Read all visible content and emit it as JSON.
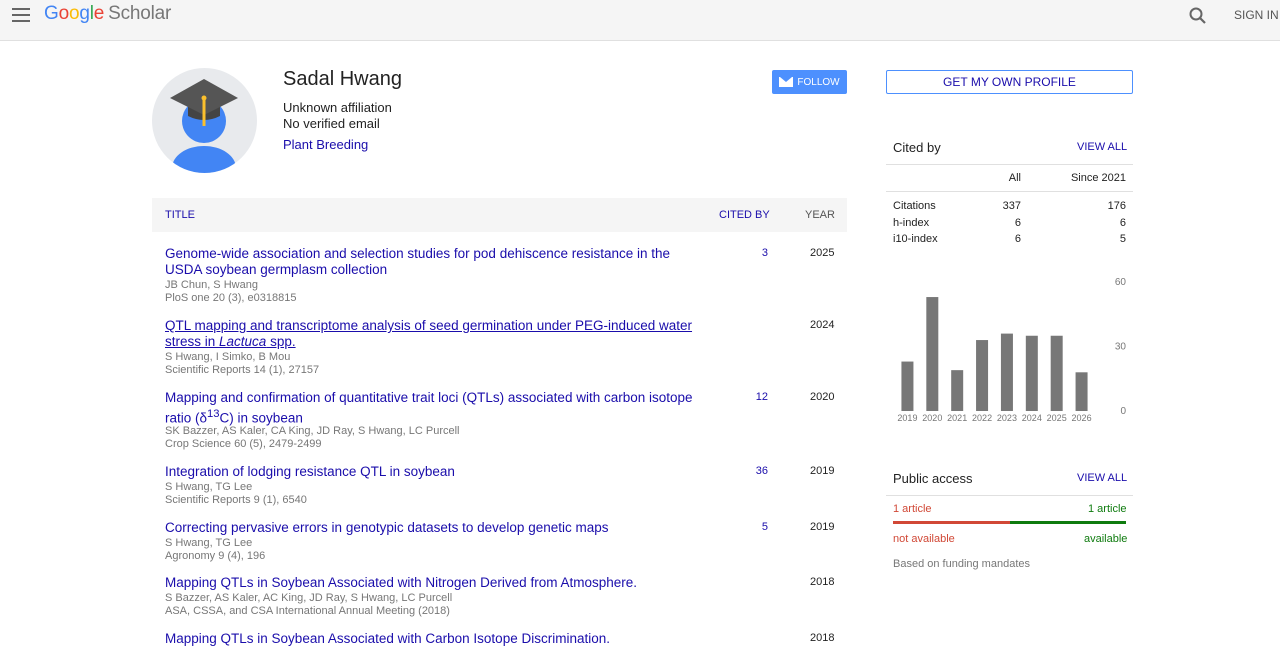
{
  "header": {
    "logo_letters": [
      "G",
      "o",
      "o",
      "g",
      "l",
      "e"
    ],
    "logo_product": "Scholar",
    "signin_label": "SIGN IN",
    "menu_icon": "hamburger-menu-icon",
    "search_icon": "search-icon"
  },
  "profile": {
    "name": "Sadal Hwang",
    "affiliation": "Unknown affiliation",
    "email": "No verified email",
    "interest": "Plant Breeding",
    "follow_label": "FOLLOW"
  },
  "table": {
    "headers": {
      "title": "TITLE",
      "cited_by": "CITED BY",
      "year": "YEAR"
    },
    "rows": [
      {
        "title": "Genome-wide association and selection studies for pod dehiscence resistance in the USDA soybean germplasm collection",
        "authors": "JB Chun, S Hwang",
        "venue": "PloS one 20 (3), e0318815",
        "cited": "3",
        "year": "2025"
      },
      {
        "title_pre": "QTL mapping and transcriptome analysis of seed germination under PEG-induced water stress in ",
        "title_italic": "Lactuca",
        "title_post": " spp.",
        "authors": "S Hwang, I Simko, B Mou",
        "venue": "Scientific Reports 14 (1), 27157",
        "cited": "",
        "year": "2024"
      },
      {
        "title_pre": "Mapping and confirmation of quantitative trait loci (QTLs) associated with carbon isotope ratio (δ",
        "title_sup": "13",
        "title_post": "C) in soybean",
        "authors": "SK Bazzer, AS Kaler, CA King, JD Ray, S Hwang, LC Purcell",
        "venue": "Crop Science 60 (5), 2479-2499",
        "cited": "12",
        "year": "2020"
      },
      {
        "title": "Integration of lodging resistance QTL in soybean",
        "authors": "S Hwang, TG Lee",
        "venue": "Scientific Reports 9 (1), 6540",
        "cited": "36",
        "year": "2019"
      },
      {
        "title": "Correcting pervasive errors in genotypic datasets to develop genetic maps",
        "authors": "S Hwang, TG Lee",
        "venue": "Agronomy 9 (4), 196",
        "cited": "5",
        "year": "2019"
      },
      {
        "title": "Mapping QTLs in Soybean Associated with Nitrogen Derived from Atmosphere.",
        "authors": "S Bazzer, AS Kaler, AC King, JD Ray, S Hwang, LC Purcell",
        "venue": "ASA, CSSA, and CSA International Annual Meeting (2018)",
        "cited": "",
        "year": "2018"
      },
      {
        "title": "Mapping QTLs in Soybean Associated with Carbon Isotope Discrimination.",
        "authors": "",
        "venue": "",
        "cited": "",
        "year": "2018"
      }
    ]
  },
  "sidebar": {
    "get_profile_label": "GET MY OWN PROFILE",
    "cited_by_title": "Cited by",
    "view_all": "VIEW ALL",
    "col_all": "All",
    "col_since": "Since 2021",
    "metrics": [
      {
        "label": "Citations",
        "all": "337",
        "since": "176"
      },
      {
        "label": "h-index",
        "all": "6",
        "since": "6"
      },
      {
        "label": "i10-index",
        "all": "6",
        "since": "5"
      }
    ],
    "public_access_title": "Public access",
    "pa_not_available_count": "1 article",
    "pa_available_count": "1 article",
    "pa_not_available": "not available",
    "pa_available": "available",
    "mandates_text": "Based on funding mandates",
    "colors": {
      "not_available": "#d14836",
      "available": "#0f7b0f",
      "bar": "#777777"
    }
  },
  "chart_data": {
    "type": "bar",
    "categories": [
      "2019",
      "2020",
      "2021",
      "2022",
      "2023",
      "2024",
      "2025",
      "2026"
    ],
    "values": [
      23,
      53,
      19,
      33,
      36,
      35,
      35,
      18
    ],
    "yticks": [
      0,
      30,
      60
    ],
    "ylim": [
      0,
      60
    ],
    "title": "",
    "xlabel": "",
    "ylabel": ""
  }
}
